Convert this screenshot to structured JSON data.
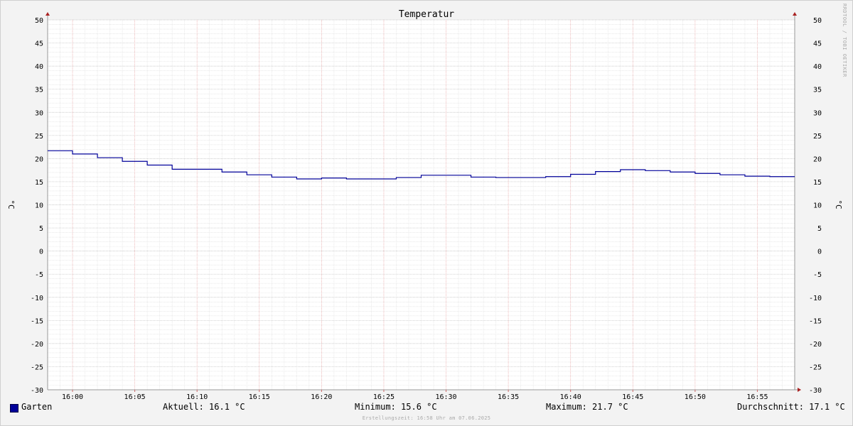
{
  "chart_data": {
    "type": "line",
    "title": "Temperatur",
    "ylabel": "°C",
    "ylabel_right": "°C",
    "ylim": [
      -30,
      50
    ],
    "yticks": [
      50,
      45,
      40,
      35,
      30,
      25,
      20,
      15,
      10,
      5,
      0,
      -5,
      -10,
      -15,
      -20,
      -25,
      -30
    ],
    "xlim": [
      "15:58",
      "16:58"
    ],
    "xticks": [
      "16:00",
      "16:05",
      "16:10",
      "16:15",
      "16:20",
      "16:25",
      "16:30",
      "16:35",
      "16:40",
      "16:45",
      "16:50",
      "16:55"
    ],
    "grid": true,
    "series": [
      {
        "name": "Garten",
        "color": "#000099",
        "x": [
          "15:58",
          "16:00",
          "16:02",
          "16:04",
          "16:06",
          "16:08",
          "16:10",
          "16:12",
          "16:14",
          "16:16",
          "16:18",
          "16:20",
          "16:22",
          "16:24",
          "16:26",
          "16:28",
          "16:30",
          "16:32",
          "16:34",
          "16:36",
          "16:38",
          "16:40",
          "16:42",
          "16:44",
          "16:46",
          "16:48",
          "16:50",
          "16:52",
          "16:54",
          "16:56"
        ],
        "y": [
          21.7,
          21.0,
          20.2,
          19.4,
          18.6,
          17.7,
          17.7,
          17.1,
          16.5,
          16.0,
          15.6,
          15.8,
          15.6,
          15.6,
          15.9,
          16.4,
          16.4,
          16.0,
          15.9,
          15.9,
          16.1,
          16.6,
          17.2,
          17.6,
          17.4,
          17.1,
          16.8,
          16.5,
          16.2,
          16.1
        ]
      }
    ]
  },
  "legend": {
    "series_name": "Garten",
    "current": "Aktuell: 16.1 °C",
    "minimum": "Minimum: 15.6 °C",
    "maximum": "Maximum: 21.7 °C",
    "average": "Durchschnitt: 17.1 °C"
  },
  "footer": "Erstellungszeit: 16:58 Uhr am 07.06.2025",
  "watermark": "RRDTOOL / TOBI OETIKER"
}
